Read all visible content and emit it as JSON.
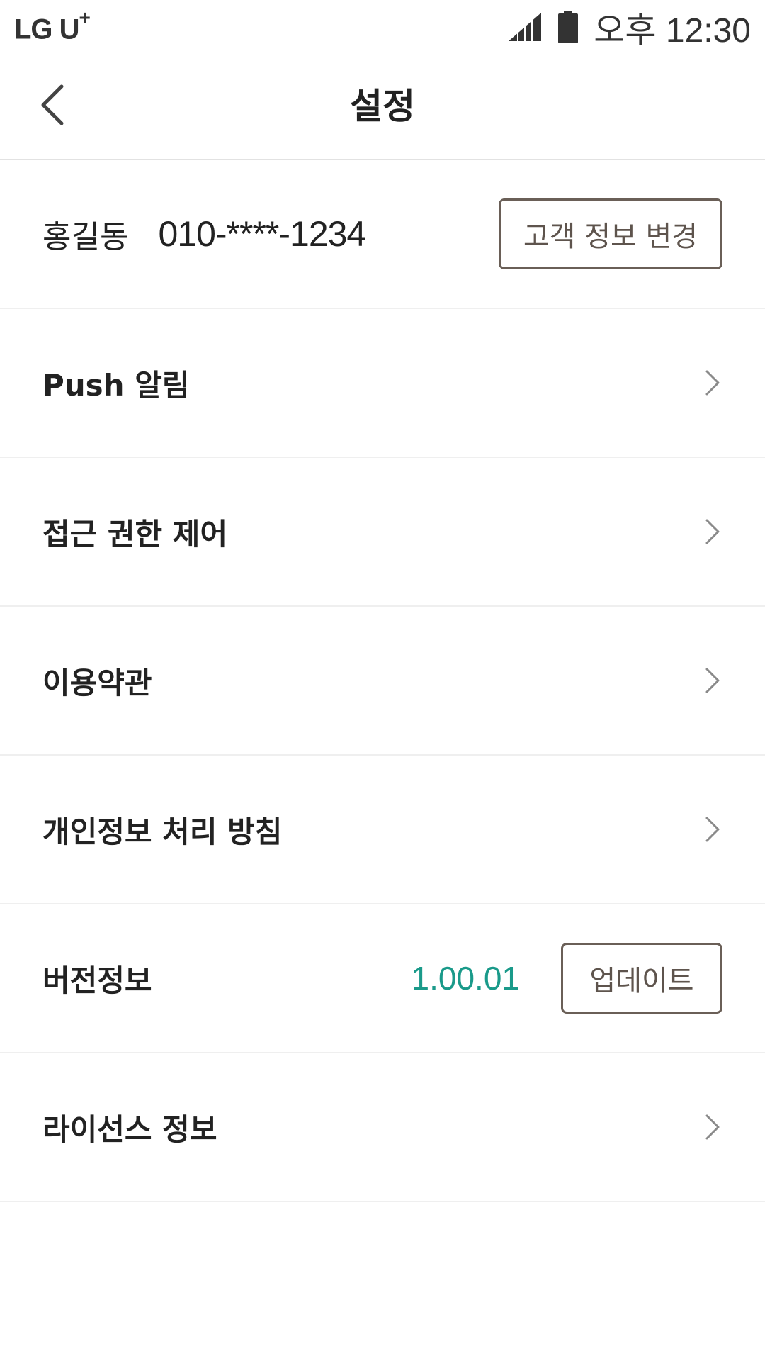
{
  "status_bar": {
    "carrier": "LG U",
    "carrier_sup": "+",
    "time": "오후 12:30",
    "icons": [
      "signal-icon",
      "battery-icon"
    ]
  },
  "header": {
    "title": "설정",
    "back_icon": "chevron-left-icon"
  },
  "profile": {
    "name": "홍길동",
    "phone": "010-****-1234",
    "edit_button_label": "고객 정보 변경"
  },
  "menu": {
    "push": "Push 알림",
    "permissions": "접근 권한 제어",
    "terms": "이용약관",
    "privacy": "개인정보 처리 방침",
    "version_label": "버전정보",
    "version_value": "1.00.01",
    "update_button_label": "업데이트",
    "license": "라이선스 정보"
  },
  "colors": {
    "accent_teal": "#1a9a8a",
    "button_border": "#6a5f57",
    "divider": "#efefef"
  }
}
